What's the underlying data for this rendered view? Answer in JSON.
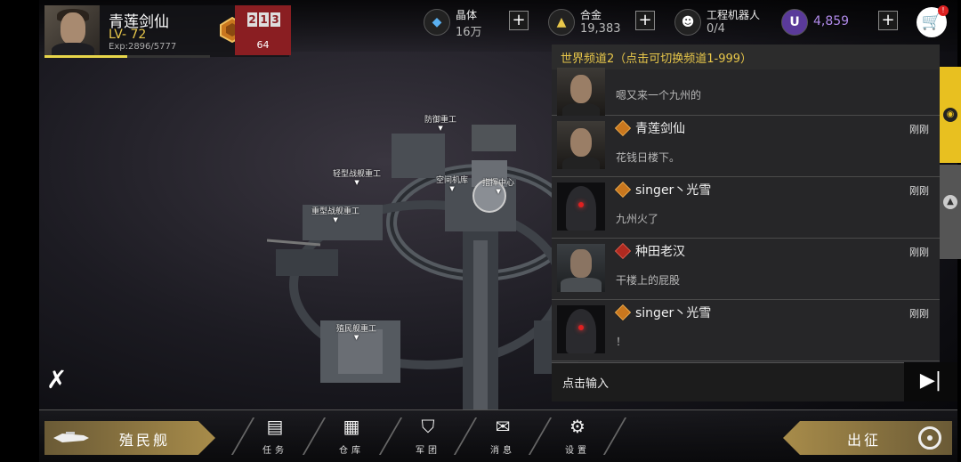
{
  "player": {
    "name": "青莲剑仙",
    "level": "LV- 72",
    "exp": "Exp:2896/5777",
    "exp_fraction": 0.501,
    "rank_digits": [
      "2",
      "1",
      "3"
    ],
    "rank_count": "64"
  },
  "resources": [
    {
      "label": "晶体",
      "value": "16万",
      "icon": "crystal-icon"
    },
    {
      "label": "合金",
      "value": "19,383",
      "icon": "alloy-icon"
    },
    {
      "label": "工程机器人",
      "value": "0/4",
      "icon": "robot-icon"
    },
    {
      "label": "",
      "value": "4,859",
      "icon": "u-currency-icon"
    }
  ],
  "station_labels": [
    "防御重工",
    "轻型战舰重工",
    "空间机库",
    "指挥中心",
    "重型战舰重工",
    "殖民舰重工"
  ],
  "chat": {
    "channel_title": "世界频道2（点击可切换频道1-999）",
    "messages": [
      {
        "name": "",
        "time": "",
        "text": "嗯又来一个九州的",
        "avatar": "man"
      },
      {
        "name": "青莲剑仙",
        "time": "刚刚",
        "text": "花钱日楼下。",
        "avatar": "man"
      },
      {
        "name": "singer丶光雪",
        "time": "刚刚",
        "text": "九州火了",
        "avatar": "hood"
      },
      {
        "name": "种田老汉",
        "time": "刚刚",
        "text": "干楼上的屁股",
        "avatar": "soldier"
      },
      {
        "name": "singer丶光雪",
        "time": "刚刚",
        "text": "！",
        "avatar": "hood"
      }
    ],
    "input_placeholder": "点击输入",
    "send_icon": "send-icon"
  },
  "bottom": {
    "colony_label": "殖民舰",
    "nav": [
      {
        "label": "任务",
        "icon": "mission-icon"
      },
      {
        "label": "仓库",
        "icon": "warehouse-icon"
      },
      {
        "label": "军团",
        "icon": "legion-icon"
      },
      {
        "label": "消息",
        "icon": "message-icon"
      },
      {
        "label": "设置",
        "icon": "settings-icon"
      }
    ],
    "attack_label": "出征"
  },
  "colors": {
    "accent_gold": "#e8c74a",
    "rank_red": "#8a1e22",
    "chat_bg": "#28282a"
  }
}
